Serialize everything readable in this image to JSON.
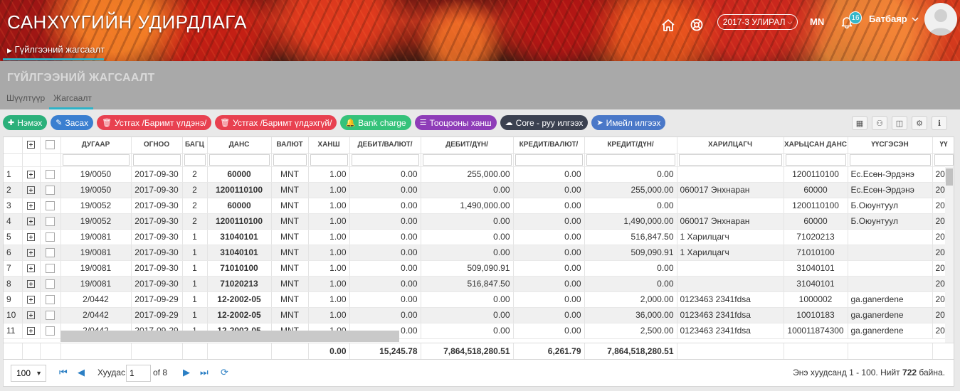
{
  "header": {
    "title": "САНХҮҮГИЙН УДИРДЛАГА",
    "breadcrumb": "Гүйлгээний жагсаалт",
    "period": "2017-3 УЛИРАЛ",
    "language": "MN",
    "notification_count": "16",
    "user_name": "Батбаяр"
  },
  "page": {
    "title": "ГҮЙЛГЭЭНИЙ ЖАГСААЛТ",
    "tabs": [
      "Шүүлтүүр",
      "Жагсаалт"
    ]
  },
  "toolbar": {
    "buttons": [
      {
        "label": "Нэмэх",
        "icon": "plus-icon",
        "color": "#2bb07a"
      },
      {
        "label": "Засах",
        "icon": "edit-icon",
        "color": "#3a7fd0"
      },
      {
        "label": "Устгах /Баримт үлдэнэ/",
        "icon": "trash-icon",
        "color": "#e84150"
      },
      {
        "label": "Устгах /Баримт үлдэхгүй/",
        "icon": "trash-icon",
        "color": "#e84150"
      },
      {
        "label": "Bank charge",
        "icon": "bell-icon",
        "color": "#35c27a"
      },
      {
        "label": "Тооцооны ханш",
        "icon": "list-icon",
        "color": "#8e3db8"
      },
      {
        "label": "Core - руу илгээх",
        "icon": "cloud-upload-icon",
        "color": "#3b4150"
      },
      {
        "label": "Имейл илгээх",
        "icon": "send-icon",
        "color": "#4a78c8"
      }
    ],
    "right_icons": [
      "qr-icon",
      "excel-icon",
      "columns-icon",
      "settings-icon",
      "info-icon"
    ]
  },
  "table": {
    "columns": [
      "ДУГААР",
      "ОГНОО",
      "БАГЦ",
      "ДАНС",
      "ВАЛЮТ",
      "ХАНШ",
      "ДЕБИТ/ВАЛЮТ/",
      "ДЕБИТ/ДҮН/",
      "КРЕДИТ/ВАЛЮТ/",
      "КРЕДИТ/ДҮН/",
      "ХАРИЛЦАГЧ",
      "ХАРЬЦСАН ДАНС",
      "ҮҮСГЭСЭН",
      "ҮҮ"
    ],
    "rows": [
      [
        "1",
        "19/0050",
        "2017-09-30",
        "2",
        "60000",
        "MNT",
        "1.00",
        "0.00",
        "255,000.00",
        "0.00",
        "0.00",
        "",
        "1200110100",
        "Ес.Есөн-Эрдэнэ",
        "20"
      ],
      [
        "2",
        "19/0050",
        "2017-09-30",
        "2",
        "1200110100",
        "MNT",
        "1.00",
        "0.00",
        "0.00",
        "0.00",
        "255,000.00",
        "060017 Энхнаран",
        "60000",
        "Ес.Есөн-Эрдэнэ",
        "20"
      ],
      [
        "3",
        "19/0052",
        "2017-09-30",
        "2",
        "60000",
        "MNT",
        "1.00",
        "0.00",
        "1,490,000.00",
        "0.00",
        "0.00",
        "",
        "1200110100",
        "Б.Оюунтуул",
        "20"
      ],
      [
        "4",
        "19/0052",
        "2017-09-30",
        "2",
        "1200110100",
        "MNT",
        "1.00",
        "0.00",
        "0.00",
        "0.00",
        "1,490,000.00",
        "060017 Энхнаран",
        "60000",
        "Б.Оюунтуул",
        "20"
      ],
      [
        "5",
        "19/0081",
        "2017-09-30",
        "1",
        "31040101",
        "MNT",
        "1.00",
        "0.00",
        "0.00",
        "0.00",
        "516,847.50",
        "1 Харилцагч",
        "71020213",
        "",
        "20"
      ],
      [
        "6",
        "19/0081",
        "2017-09-30",
        "1",
        "31040101",
        "MNT",
        "1.00",
        "0.00",
        "0.00",
        "0.00",
        "509,090.91",
        "1 Харилцагч",
        "71010100",
        "",
        "20"
      ],
      [
        "7",
        "19/0081",
        "2017-09-30",
        "1",
        "71010100",
        "MNT",
        "1.00",
        "0.00",
        "509,090.91",
        "0.00",
        "0.00",
        "",
        "31040101",
        "",
        "20"
      ],
      [
        "8",
        "19/0081",
        "2017-09-30",
        "1",
        "71020213",
        "MNT",
        "1.00",
        "0.00",
        "516,847.50",
        "0.00",
        "0.00",
        "",
        "31040101",
        "",
        "20"
      ],
      [
        "9",
        "2/0442",
        "2017-09-29",
        "1",
        "12-2002-05",
        "MNT",
        "1.00",
        "0.00",
        "0.00",
        "0.00",
        "2,000.00",
        "0123463 2341fdsa",
        "1000002",
        "ga.ganerdene",
        "20"
      ],
      [
        "10",
        "2/0442",
        "2017-09-29",
        "1",
        "12-2002-05",
        "MNT",
        "1.00",
        "0.00",
        "0.00",
        "0.00",
        "36,000.00",
        "0123463 2341fdsa",
        "10010183",
        "ga.ganerdene",
        "20"
      ],
      [
        "11",
        "2/0442",
        "2017-09-29",
        "1",
        "12-2002-05",
        "MNT",
        "1.00",
        "0.00",
        "0.00",
        "0.00",
        "2,500.00",
        "0123463 2341fdsa",
        "100011874300",
        "ga.ganerdene",
        "20"
      ]
    ],
    "totals": {
      "rate": "0.00",
      "debit_currency": "15,245.78",
      "debit_amount": "7,864,518,280.51",
      "credit_currency": "6,261.79",
      "credit_amount": "7,864,518,280.51"
    }
  },
  "pager": {
    "page_size": "100",
    "page_label": "Хуудас",
    "current_page": "1",
    "of_pages": "of 8",
    "summary_prefix": "Энэ хуудсанд 1 - 100. Нийт",
    "total": "722",
    "summary_suffix": "байна."
  }
}
